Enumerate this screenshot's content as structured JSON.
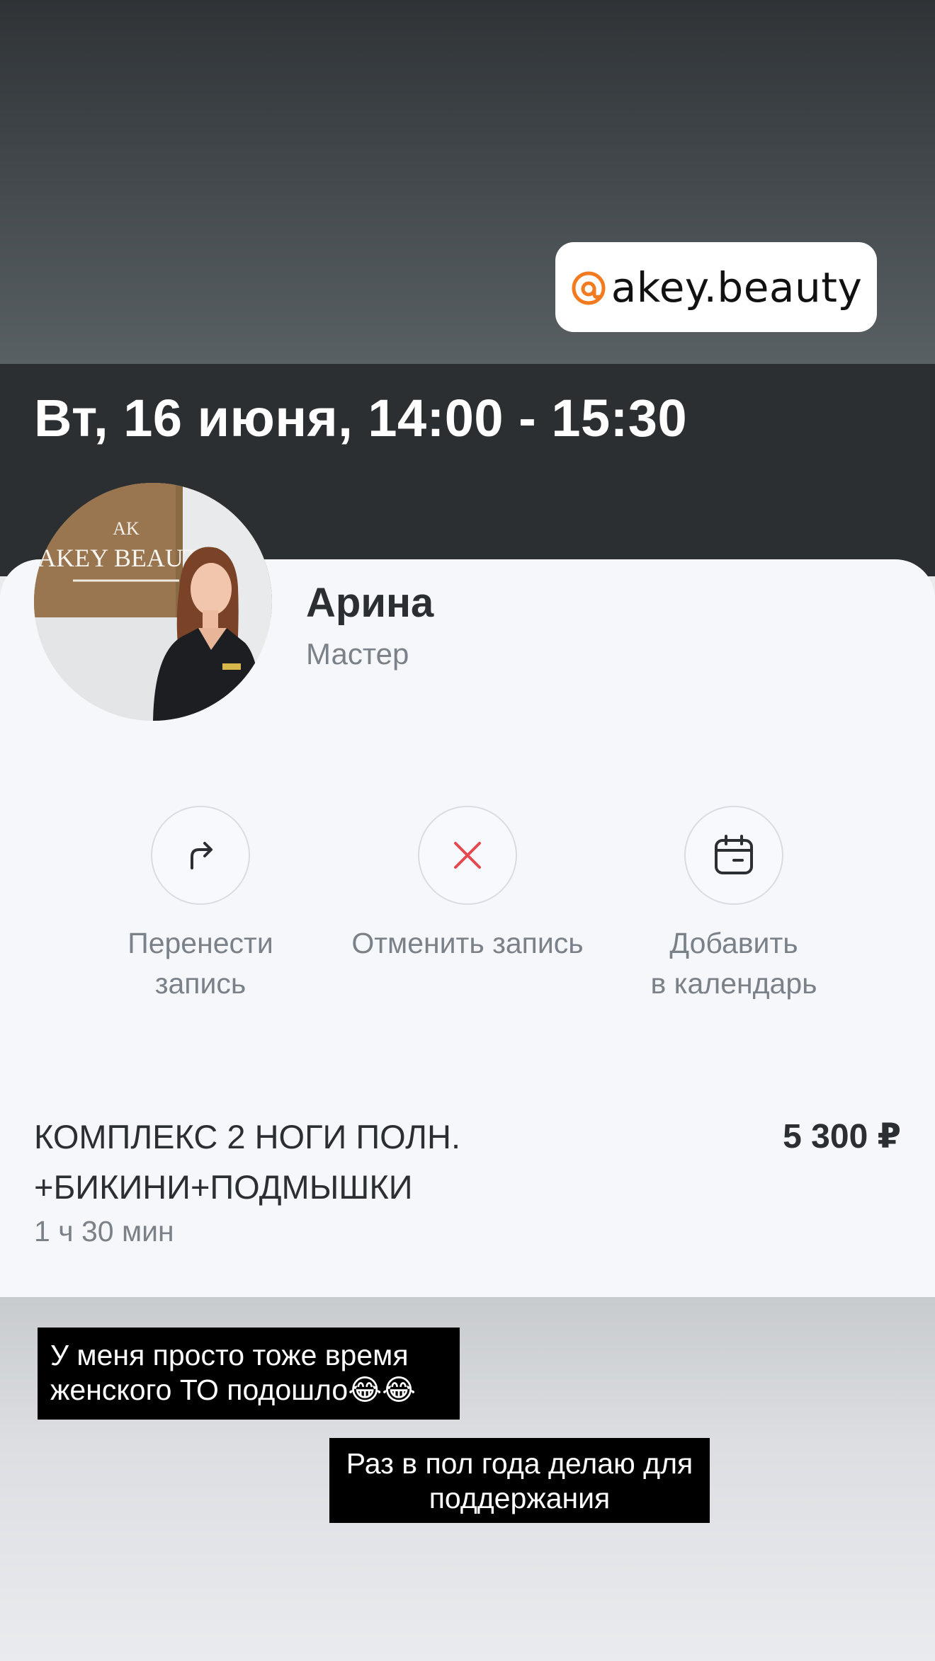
{
  "story": {
    "threads_handle": "akey.beauty",
    "threads_icon": "threads-logo-icon",
    "accent_color": "#f47a1f"
  },
  "appointment": {
    "datetime": "Вт, 16 июня, 14:00 - 15:30"
  },
  "master": {
    "name": "Арина",
    "role": "Мастер",
    "photo_sign_text": "AKEY BEAUTY"
  },
  "actions": [
    {
      "label": "Перенести\nзапись",
      "icon": "reschedule-arrow-icon"
    },
    {
      "label": "Отменить запись",
      "icon": "cancel-x-icon",
      "icon_color": "#e5484d"
    },
    {
      "label": "Добавить\nв календарь",
      "icon": "calendar-icon"
    }
  ],
  "service": {
    "name": "КОМПЛЕКС 2 НОГИ ПОЛН.\n+БИКИНИ+ПОДМЫШКИ",
    "price": "5 300 ₽",
    "duration": "1 ч 30 мин"
  },
  "captions": [
    "У меня просто тоже время\nженского ТО подошло😂😂",
    "Раз в пол года делаю для\nподдержания"
  ]
}
